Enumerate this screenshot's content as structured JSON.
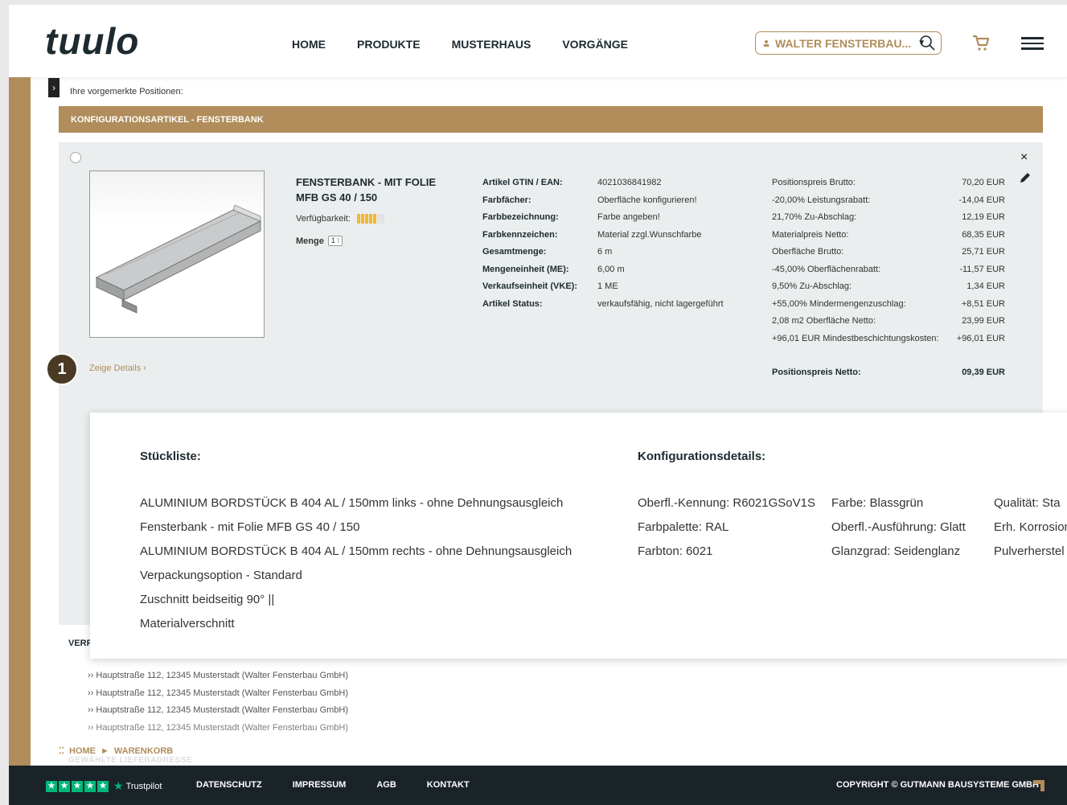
{
  "header": {
    "logo": "tuulo",
    "nav": [
      "HOME",
      "PRODUKTE",
      "MUSTERHAUS",
      "VORGÄNGE"
    ],
    "customer": "WALTER FENSTERBAU..."
  },
  "content": {
    "intro": "Ihre vorgemerkte Positionen:",
    "section_title": "KONFIGURATIONSARTIKEL - FENSTERBANK",
    "close_symbol": "×",
    "product": {
      "title_line1": "FENSTERBANK - MIT FOLIE",
      "title_line2": "MFB GS 40 / 150",
      "availability_label": "Verfügbarkeit:",
      "availability_level": 0.6,
      "quantity_label": "Menge",
      "quantity": "1 ⁝"
    },
    "attributes": [
      {
        "k": "Artikel GTIN / EAN:",
        "v": "4021036841982"
      },
      {
        "k": "Farbfächer:",
        "v": "Oberfläche konfigurieren!"
      },
      {
        "k": "Farbbezeichnung:",
        "v": "Farbe angeben!"
      },
      {
        "k": "Farbkennzeichen:",
        "v": "Material zzgl.Wunschfarbe"
      },
      {
        "k": "Gesamtmenge:",
        "v": "6 m"
      },
      {
        "k": "Mengeneinheit (ME):",
        "v": "6,00 m"
      },
      {
        "k": "Verkaufseinheit (VKE):",
        "v": "1 ME"
      },
      {
        "k": "Artikel Status:",
        "v": "verkaufsfähig, nicht lagergeführt"
      }
    ],
    "prices": [
      {
        "k": "Positionspreis Brutto:",
        "v": "70,20 EUR"
      },
      {
        "k": "-20,00% Leistungsrabatt:",
        "v": "-14,04 EUR"
      },
      {
        "k": "21,70% Zu-Abschlag:",
        "v": "12,19 EUR"
      },
      {
        "k": "Materialpreis Netto:",
        "v": "68,35 EUR"
      },
      {
        "k": "Oberfläche Brutto:",
        "v": "25,71 EUR"
      },
      {
        "k": "-45,00% Oberflächenrabatt:",
        "v": "-11,57 EUR"
      },
      {
        "k": "9,50% Zu-Abschlag:",
        "v": "1,34 EUR"
      },
      {
        "k": "+55,00% Mindermengenzuschlag:",
        "v": "+8,51 EUR"
      },
      {
        "k": "2,08 m2 Oberfläche Netto:",
        "v": "23,99 EUR"
      },
      {
        "k": "+96,01 EUR Mindestbeschichtungskosten:",
        "v": "+96,01 EUR"
      }
    ],
    "total": {
      "k": "Positionspreis Netto:",
      "v": "09,39 EUR"
    },
    "step_badge": "1",
    "details_link": "Zeige Details ‹"
  },
  "popup": {
    "list_title": "Stückliste:",
    "list": [
      "ALUMINIUM BORDSTÜCK B 404 AL / 150mm links - ohne Dehnungsausgleich",
      "Fensterbank - mit Folie MFB GS 40 / 150",
      "ALUMINIUM BORDSTÜCK B 404 AL / 150mm rechts - ohne Dehnungsausgleich",
      "Verpackungsoption - Standard",
      "Zuschnitt beidseitig 90° ||",
      "Materialverschnitt"
    ],
    "config_title": "Konfigurationsdetails:",
    "config_col1": [
      "Oberfl.-Kennung: R6021GSoV1S",
      "Farbpalette: RAL",
      "Farbton: 6021"
    ],
    "config_col2": [
      "Farbe: Blassgrün",
      "Oberfl.-Ausführung: Glatt",
      "Glanzgrad: Seidenglanz"
    ],
    "config_col3": [
      "Qualität: Sta",
      "Erh. Korrosion",
      "Pulverherstel"
    ]
  },
  "lower": {
    "verf_label": "VERF",
    "addresses": [
      "›› Hauptstraße 112, 12345 Musterstadt (Walter Fensterbau GmbH)",
      "›› Hauptstraße 112, 12345 Musterstadt (Walter Fensterbau GmbH)",
      "›› Hauptstraße 112, 12345 Musterstadt (Walter Fensterbau GmbH)",
      "›› Hauptstraße 112, 12345 Musterstadt (Walter Fensterbau GmbH)"
    ],
    "breadcrumb": [
      "HOME",
      "WARENKORB"
    ],
    "faded_label": "GEWÄHLTE LIEFERADRESSE"
  },
  "footer": {
    "trustpilot": "Trustpilot",
    "links": [
      "DATENSCHUTZ",
      "IMPRESSUM",
      "AGB",
      "KONTAKT"
    ],
    "copyright": "COPYRIGHT © GUTMANN BAUSYSTEME GMBH"
  },
  "colors": {
    "accent": "#b08d5a",
    "dark": "#1a2328",
    "trustpilot": "#00b67a"
  }
}
